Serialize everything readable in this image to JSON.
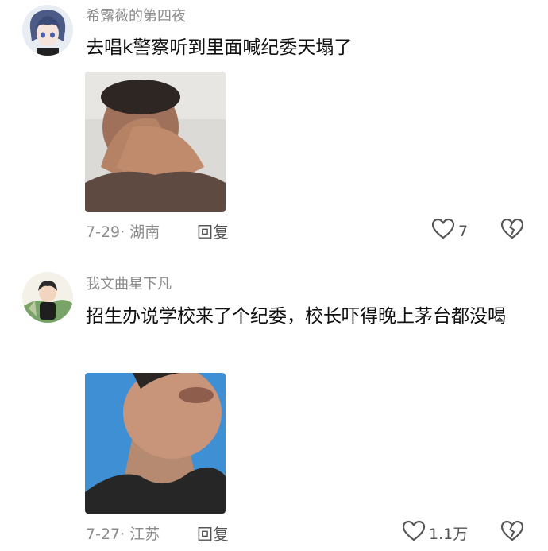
{
  "comments": [
    {
      "username": "希露薇的第四夜",
      "text": "去唱k警察听到里面喊纪委天塌了",
      "meta": "7-29· 湖南",
      "reply_label": "回复",
      "like_count": "7"
    },
    {
      "username": "我文曲星下凡",
      "text": "招生办说学校来了个纪委，校长吓得晚上茅台都没喝",
      "meta": "7-27· 江苏",
      "reply_label": "回复",
      "like_count": "1.1万"
    }
  ],
  "icons": {
    "like": "heart-outline-icon",
    "dislike": "broken-heart-icon"
  },
  "colors": {
    "meta": "#8c8c8c",
    "text": "#111111",
    "icon": "#555555"
  }
}
